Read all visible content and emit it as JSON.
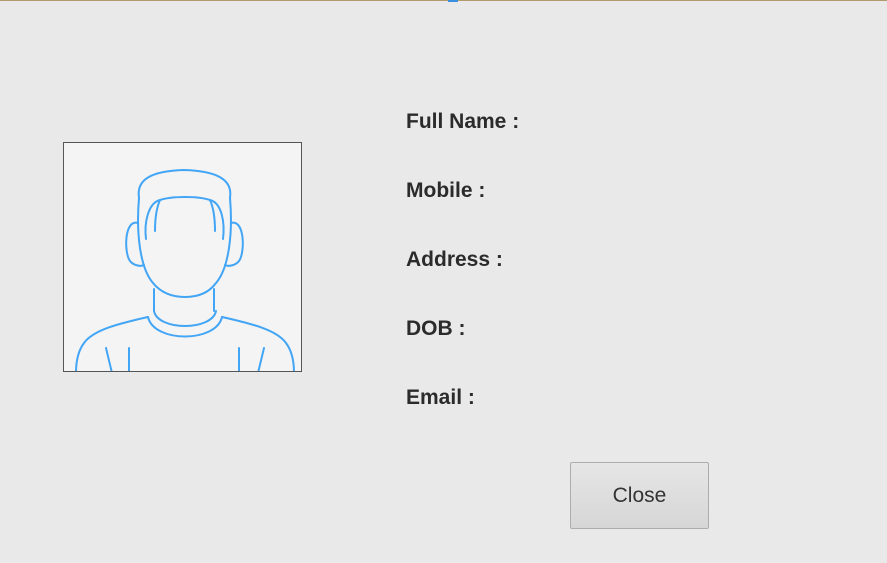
{
  "profile": {
    "photo_icon": "user-avatar-icon",
    "fields": {
      "full_name_label": "Full Name :",
      "mobile_label": "Mobile :",
      "address_label": "Address :",
      "dob_label": "DOB :",
      "email_label": "Email :"
    },
    "close_label": "Close"
  },
  "colors": {
    "background": "#e9e9e9",
    "avatar_line": "#42a5f5",
    "photo_background": "#f4f4f4",
    "label_text": "#2b2b2b"
  }
}
